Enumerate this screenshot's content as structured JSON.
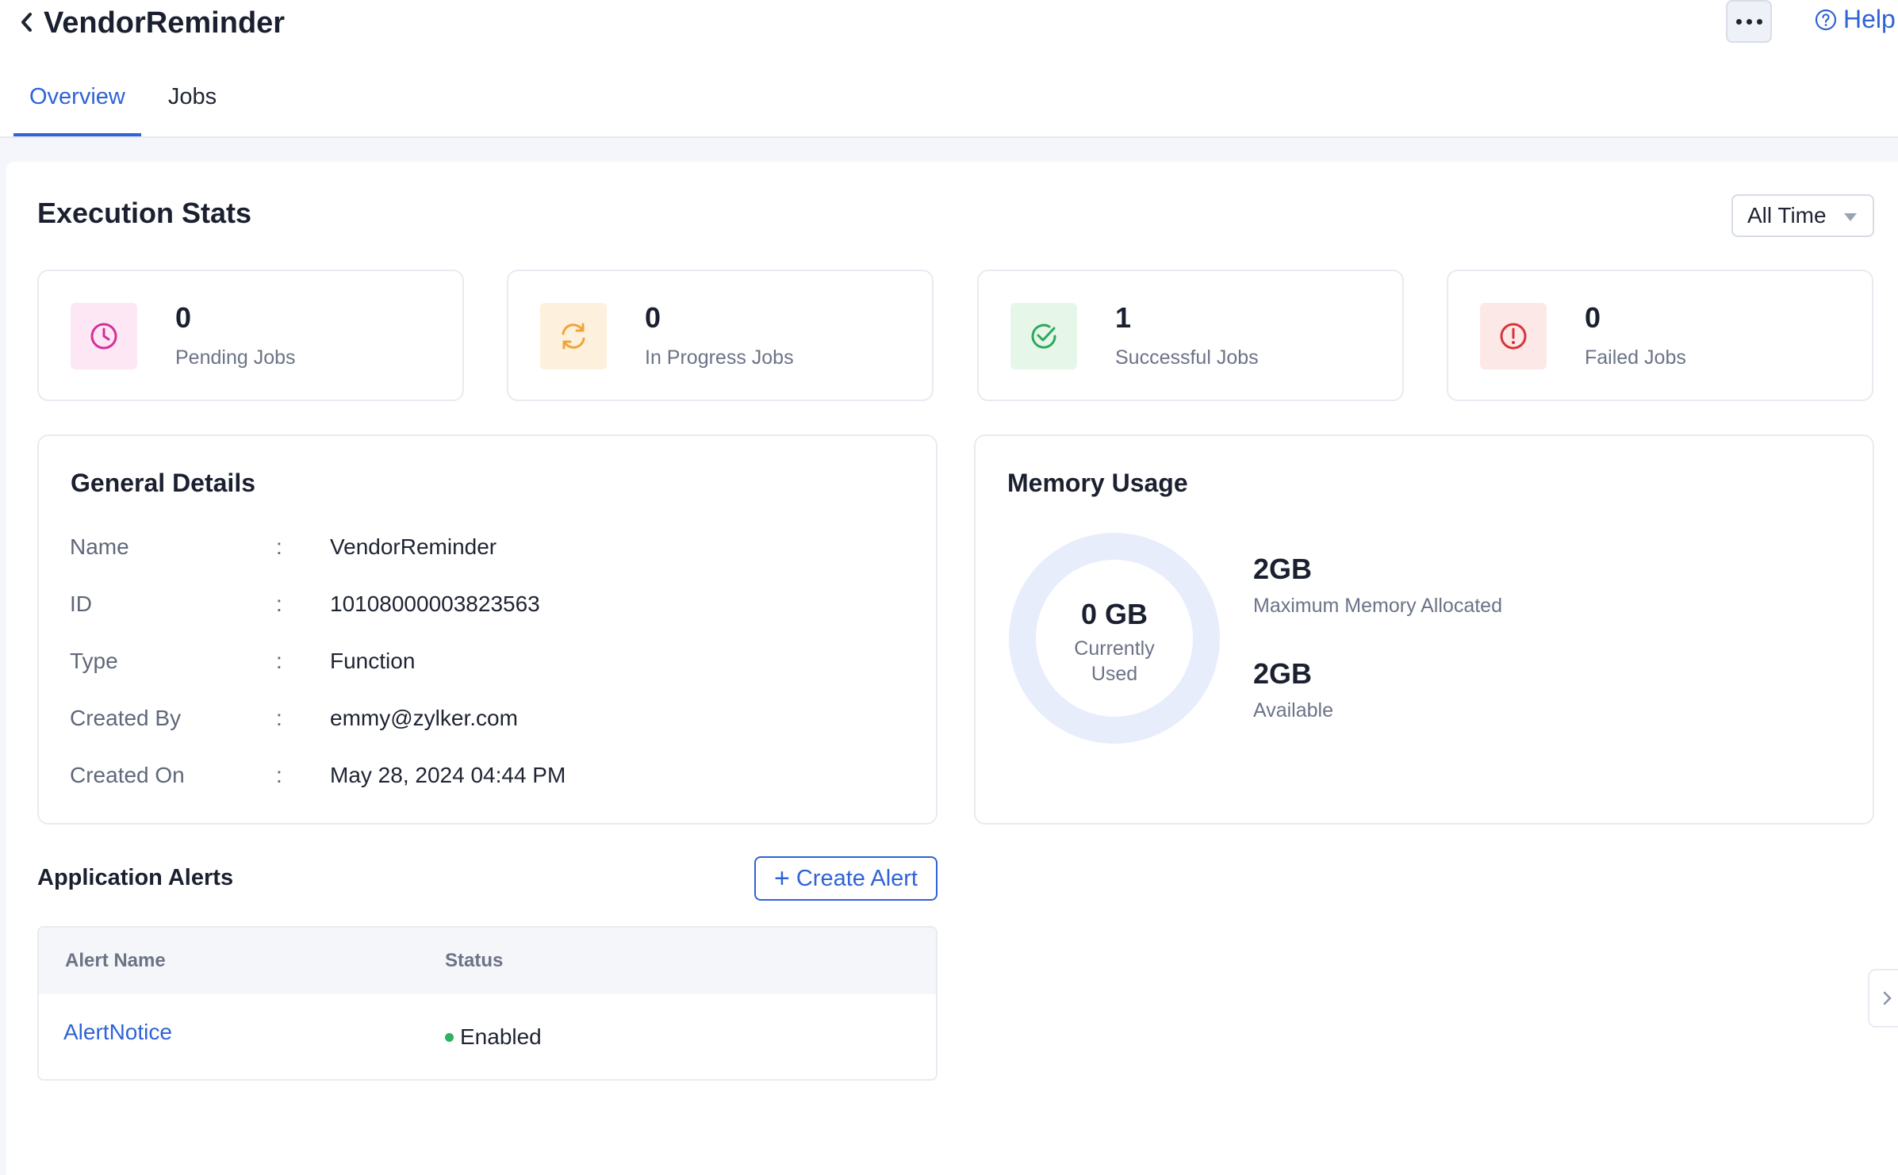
{
  "header": {
    "title": "VendorReminder",
    "help_label": "Help",
    "tabs": [
      {
        "label": "Overview"
      },
      {
        "label": "Jobs"
      }
    ]
  },
  "execution_stats": {
    "title": "Execution Stats",
    "range_select": "All Time",
    "cards": [
      {
        "value": "0",
        "label": "Pending Jobs",
        "icon": "clock-icon",
        "color": "#d32f9d",
        "bg": "#fde7f4"
      },
      {
        "value": "0",
        "label": "In Progress Jobs",
        "icon": "refresh-icon",
        "color": "#f2a43a",
        "bg": "#fdf1dd"
      },
      {
        "value": "1",
        "label": "Successful Jobs",
        "icon": "check-circle-icon",
        "color": "#2ea85a",
        "bg": "#e6f7ea"
      },
      {
        "value": "0",
        "label": "Failed Jobs",
        "icon": "alert-circle-icon",
        "color": "#d8333a",
        "bg": "#fde8e8"
      }
    ]
  },
  "general_details": {
    "title": "General Details",
    "rows": [
      {
        "key": "Name",
        "sep": ":",
        "value": "VendorReminder"
      },
      {
        "key": "ID",
        "sep": ":",
        "value": "10108000003823563"
      },
      {
        "key": "Type",
        "sep": ":",
        "value": "Function"
      },
      {
        "key": "Created By",
        "sep": ":",
        "value": "emmy@zylker.com"
      },
      {
        "key": "Created On",
        "sep": ":",
        "value": "May 28, 2024 04:44 PM"
      }
    ]
  },
  "memory_usage": {
    "title": "Memory Usage",
    "used_value": "0 GB",
    "used_label": "Currently Used",
    "used_fraction": 0,
    "max_value": "2GB",
    "max_label": "Maximum Memory Allocated",
    "available_value": "2GB",
    "available_label": "Available",
    "ring_color": "#e7edfb"
  },
  "application_alerts": {
    "title": "Application Alerts",
    "create_label": "Create Alert",
    "columns": [
      "Alert Name",
      "Status"
    ],
    "rows": [
      {
        "name": "AlertNotice",
        "status": "Enabled"
      }
    ]
  },
  "colors": {
    "accent": "#2f63d6",
    "enabled": "#2bb35e"
  }
}
